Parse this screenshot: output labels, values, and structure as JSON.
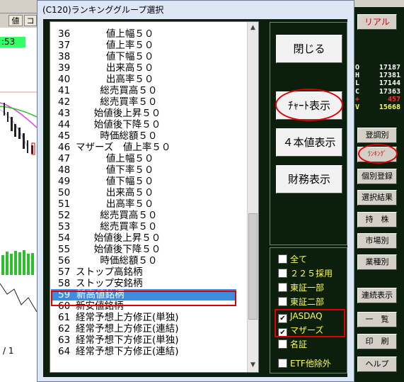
{
  "dialog": {
    "title": "(C120)ランキンググループ選択",
    "list": [
      {
        "num": "36",
        "text": "          値上幅５０"
      },
      {
        "num": "37",
        "text": "          値上率５０"
      },
      {
        "num": "38",
        "text": "          値下幅５０"
      },
      {
        "num": "39",
        "text": "          出来高５０"
      },
      {
        "num": "40",
        "text": "          出高率５０"
      },
      {
        "num": "41",
        "text": "        総売買高５０"
      },
      {
        "num": "42",
        "text": "        総売買率５０"
      },
      {
        "num": "43",
        "text": "      始値後上昇５０"
      },
      {
        "num": "44",
        "text": "      始値後下降５０"
      },
      {
        "num": "45",
        "text": "        時価総額５０"
      },
      {
        "num": "46",
        "text": "マザーズ　値上率５０"
      },
      {
        "num": "47",
        "text": "          値上幅５０"
      },
      {
        "num": "48",
        "text": "          値下率５０"
      },
      {
        "num": "49",
        "text": "          値下幅５０"
      },
      {
        "num": "50",
        "text": "          出来高５０"
      },
      {
        "num": "51",
        "text": "          出高率５０"
      },
      {
        "num": "52",
        "text": "        総売買高５０"
      },
      {
        "num": "53",
        "text": "        総売買率５０"
      },
      {
        "num": "54",
        "text": "      始値後上昇５０"
      },
      {
        "num": "55",
        "text": "      始値後下降５０"
      },
      {
        "num": "56",
        "text": "        時価総額５０"
      },
      {
        "num": "57",
        "text": "ストップ高銘柄"
      },
      {
        "num": "58",
        "text": "ストップ安銘柄"
      },
      {
        "num": "59",
        "text": "新高値銘柄"
      },
      {
        "num": "60",
        "text": "新安値銘柄"
      },
      {
        "num": "61",
        "text": "経常予想上方修正(単独)"
      },
      {
        "num": "62",
        "text": "経常予想上方修正(連結)"
      },
      {
        "num": "63",
        "text": "経常予想下方修正(単独)"
      },
      {
        "num": "64",
        "text": "経常予想下方修正(連結)"
      }
    ],
    "selected_num": "59",
    "buttons": {
      "close": "閉じる",
      "chart": "ﾁｬｰﾄ表示",
      "four_value": "４本値表示",
      "financial": "財務表示"
    },
    "filters": [
      {
        "label": "全て",
        "checked": false
      },
      {
        "label": "２２５採用",
        "checked": false
      },
      {
        "label": "東証一部",
        "checked": false
      },
      {
        "label": "東証二部",
        "checked": false
      },
      {
        "label": "JASDAQ",
        "checked": true
      },
      {
        "label": "マザーズ",
        "checked": true
      },
      {
        "label": "名証",
        "checked": false
      },
      {
        "label": "ETF他除外",
        "checked": false
      }
    ],
    "check_mark": "✔"
  },
  "right_panel": {
    "real_label": "リアル",
    "ohlc": [
      {
        "k": "O",
        "v": "17187",
        "color": "white"
      },
      {
        "k": "H",
        "v": "17381",
        "color": "white"
      },
      {
        "k": "L",
        "v": "17144",
        "color": "white"
      },
      {
        "k": "C",
        "v": "17363",
        "color": "white"
      },
      {
        "k": "+",
        "v": "457",
        "color": "red"
      },
      {
        "k": "V",
        "v": "15668",
        "color": "yellow"
      }
    ],
    "buttons": [
      "登調別",
      "ﾗﾝｷﾝｸﾞ",
      "個別登録",
      "選択結果",
      "持　株",
      "市場別",
      "業種別",
      "連続表示",
      "一　覧",
      "印　刷",
      "ヘルプ"
    ]
  },
  "background_app": {
    "tab1": "値",
    "tab2": "コ",
    "price": ":53",
    "fraction": "/ 1"
  },
  "colors": {
    "panel_green": "#0c1f0c",
    "selection_blue": "#3b8de2",
    "annotation_red": "#e00000",
    "label_yellow": "#ffff40"
  }
}
